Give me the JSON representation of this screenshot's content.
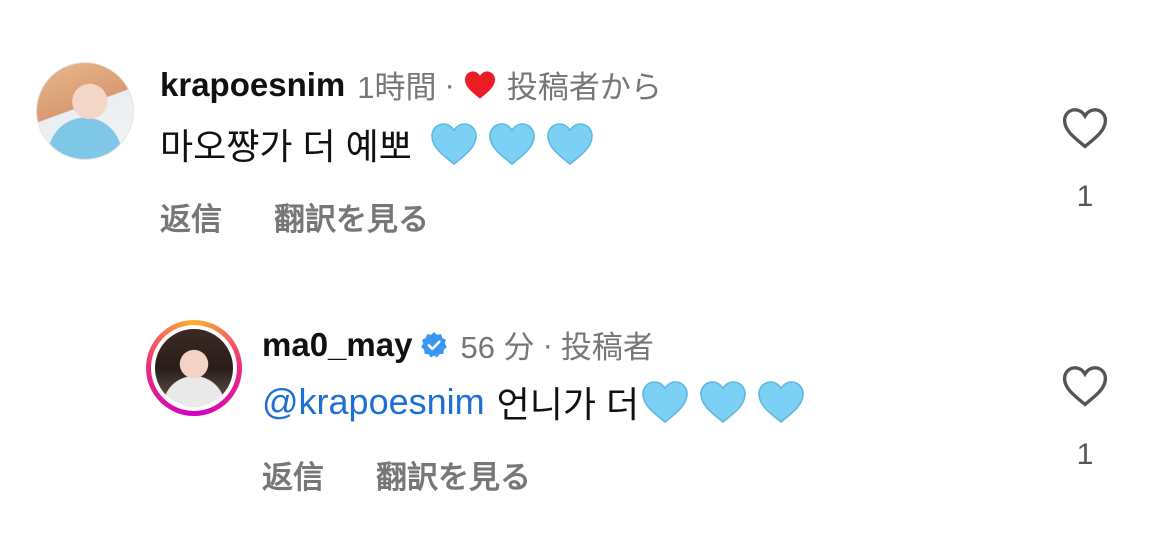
{
  "icons": {
    "liked_by_author": "heart-icon",
    "verified": "verified-badge-icon",
    "like": "heart-outline-icon",
    "emoji": "blue-heart-emoji"
  },
  "colors": {
    "liked_heart": "#ee1c25",
    "blue_heart": "#7cd0f4",
    "mention": "#1d6fd6",
    "muted_text": "#777777",
    "verified": "#3897f0"
  },
  "comments": [
    {
      "username": "krapoesnim",
      "time": "1時間",
      "separator": "·",
      "author_tag": "投稿者から",
      "text": "마오쨩가 더 예뽀",
      "emoji_count": 3,
      "reply_label": "返信",
      "translate_label": "翻訳を見る",
      "like_count": "1"
    },
    {
      "username": "ma0_may",
      "time": "56 分",
      "separator": "·",
      "author_tag": "投稿者",
      "mention": "@krapoesnim",
      "text": "언니가 더",
      "emoji_count": 3,
      "reply_label": "返信",
      "translate_label": "翻訳を見る",
      "like_count": "1"
    }
  ]
}
